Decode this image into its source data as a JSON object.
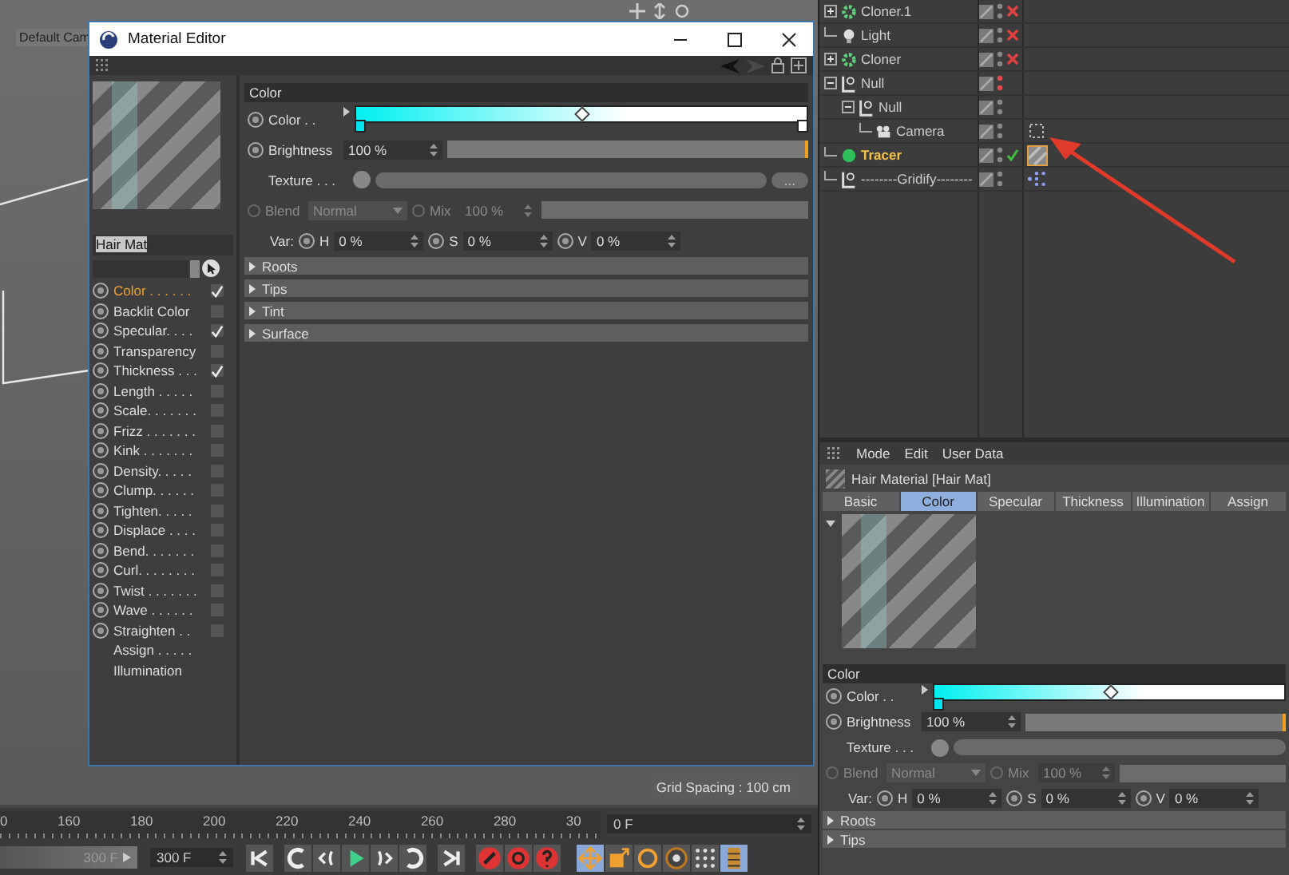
{
  "viewport": {
    "camera_label": "Default Cam",
    "grid_spacing": "Grid Spacing : 100 cm"
  },
  "material_editor": {
    "title": "Material Editor",
    "name": "Hair Mat",
    "channels": [
      {
        "label": "Color . . . . . .",
        "kind": "toggle",
        "checked": true,
        "selected": true
      },
      {
        "label": "Backlit Color",
        "kind": "toggle",
        "checked": false,
        "selected": false
      },
      {
        "label": "Specular. . . .",
        "kind": "toggle",
        "checked": true,
        "selected": false
      },
      {
        "label": "Transparency",
        "kind": "toggle",
        "checked": false,
        "selected": false
      },
      {
        "label": "Thickness . . .",
        "kind": "toggle",
        "checked": true,
        "selected": false
      },
      {
        "label": "Length . . . . .",
        "kind": "toggle",
        "checked": false,
        "selected": false
      },
      {
        "label": "Scale. . . . . . .",
        "kind": "toggle",
        "checked": false,
        "selected": false
      },
      {
        "label": "Frizz . . . . . . .",
        "kind": "toggle",
        "checked": false,
        "selected": false
      },
      {
        "label": "Kink . . . . . . .",
        "kind": "toggle",
        "checked": false,
        "selected": false
      },
      {
        "label": "Density. . . . .",
        "kind": "toggle",
        "checked": false,
        "selected": false
      },
      {
        "label": "Clump. . . . . .",
        "kind": "toggle",
        "checked": false,
        "selected": false
      },
      {
        "label": "Tighten. . . . .",
        "kind": "toggle",
        "checked": false,
        "selected": false
      },
      {
        "label": "Displace . . . .",
        "kind": "toggle",
        "checked": false,
        "selected": false
      },
      {
        "label": "Bend. . . . . . .",
        "kind": "toggle",
        "checked": false,
        "selected": false
      },
      {
        "label": "Curl. . . . . . . .",
        "kind": "toggle",
        "checked": false,
        "selected": false
      },
      {
        "label": "Twist . . . . . . .",
        "kind": "toggle",
        "checked": false,
        "selected": false
      },
      {
        "label": "Wave . . . . . .",
        "kind": "toggle",
        "checked": false,
        "selected": false
      },
      {
        "label": "Straighten . .",
        "kind": "toggle",
        "checked": false,
        "selected": false
      },
      {
        "label": "Assign . . . . .",
        "kind": "page",
        "selected": false
      },
      {
        "label": "Illumination",
        "kind": "page",
        "selected": false
      }
    ],
    "panel": {
      "section": "Color",
      "color_label": "Color . .",
      "knots": [
        {
          "color": "#00e5f0"
        },
        {
          "color": "#ffffff"
        }
      ],
      "brightness": {
        "label": "Brightness",
        "value": "100 %",
        "level": 1
      },
      "texture_label": "Texture . . .",
      "texture_button": "...",
      "blend": {
        "label": "Blend",
        "value": "Normal",
        "disabled": true
      },
      "mix": {
        "label": "Mix",
        "value": "100 %",
        "level": 1,
        "disabled": true
      },
      "variation_label": "Var:",
      "variations": [
        {
          "label": "H",
          "value": "0 %"
        },
        {
          "label": "S",
          "value": "0 %"
        },
        {
          "label": "V",
          "value": "0 %"
        }
      ],
      "groups": [
        {
          "label": "Roots",
          "expanded": false
        },
        {
          "label": "Tips",
          "expanded": false
        },
        {
          "label": "Tint",
          "expanded": false
        },
        {
          "label": "Surface",
          "expanded": false
        }
      ]
    }
  },
  "object_manager": {
    "objects": [
      {
        "name": "Cloner.1",
        "kind": "cloner",
        "expanded": false,
        "selected": false,
        "disabled": true,
        "checked": false,
        "hidden": false
      },
      {
        "name": "Light",
        "kind": "light",
        "selected": false,
        "disabled": true,
        "checked": false,
        "hidden": false
      },
      {
        "name": "Cloner",
        "kind": "cloner",
        "expanded": false,
        "selected": false,
        "disabled": true,
        "checked": false,
        "hidden": false
      },
      {
        "name": "Null",
        "kind": "null",
        "expanded": true,
        "selected": false,
        "disabled": false,
        "checked": false,
        "hidden": true,
        "children": [
          {
            "name": "Null",
            "kind": "null",
            "expanded": true,
            "selected": false,
            "disabled": false,
            "checked": false,
            "hidden": false,
            "children": [
              {
                "name": "Camera",
                "kind": "camera",
                "selected": false,
                "disabled": false,
                "checked": false,
                "hidden": false,
                "tags": [
                  {
                    "kind": "target",
                    "selected": false
                  }
                ]
              }
            ]
          }
        ]
      },
      {
        "name": "Tracer",
        "kind": "tracer",
        "selected": true,
        "disabled": false,
        "checked": true,
        "hidden": false,
        "tags": [
          {
            "kind": "material",
            "selected": true
          }
        ]
      },
      {
        "name": "--------Gridify--------",
        "kind": "null",
        "selected": false,
        "disabled": false,
        "checked": false,
        "hidden": false,
        "tags": [
          {
            "kind": "nodes",
            "selected": false
          }
        ]
      }
    ]
  },
  "attribute_manager": {
    "menu": [
      "Mode",
      "Edit",
      "User Data"
    ],
    "title": "Hair Material [Hair Mat]",
    "tabs": [
      {
        "label": "Basic",
        "selected": false
      },
      {
        "label": "Color",
        "selected": true
      },
      {
        "label": "Specular",
        "selected": false
      },
      {
        "label": "Thickness",
        "selected": false
      },
      {
        "label": "Illumination",
        "selected": false
      },
      {
        "label": "Assign",
        "selected": false
      }
    ],
    "panel": {
      "section": "Color",
      "color_label": "Color . .",
      "knots": [
        {
          "color": "#00e5f0"
        }
      ],
      "brightness": {
        "label": "Brightness",
        "value": "100 %",
        "level": 1
      },
      "texture_label": "Texture . . .",
      "blend": {
        "label": "Blend",
        "value": "Normal",
        "disabled": true
      },
      "mix": {
        "label": "Mix",
        "value": "100 %",
        "level": 1,
        "disabled": true
      },
      "variation_label": "Var:",
      "variations": [
        {
          "label": "H",
          "value": "0 %"
        },
        {
          "label": "S",
          "value": "0 %"
        },
        {
          "label": "V",
          "value": "0 %"
        }
      ],
      "groups": [
        {
          "label": "Roots",
          "expanded": false
        },
        {
          "label": "Tips",
          "expanded": false
        }
      ]
    }
  },
  "timeline": {
    "ruler": [
      "0",
      "160",
      "180",
      "200",
      "220",
      "240",
      "260",
      "280",
      "30"
    ],
    "frame": "0 F",
    "range_end": "300 F",
    "max_frame": "300 F",
    "tools": [
      {
        "kind": "move",
        "selected": true
      },
      {
        "kind": "scale",
        "selected": false
      },
      {
        "kind": "rotate",
        "selected": false
      },
      {
        "kind": "param",
        "selected": false
      },
      {
        "kind": "points",
        "selected": false
      },
      {
        "kind": "layout",
        "selected": true
      }
    ]
  }
}
